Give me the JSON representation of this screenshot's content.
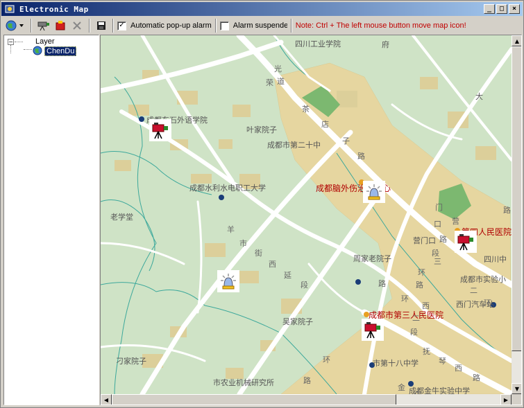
{
  "window": {
    "title": "Electronic Map",
    "buttons": {
      "minimize": "_",
      "maximize": "□",
      "close": "×"
    }
  },
  "toolbar": {
    "auto_popup_label": "Automatic pop-up alarm",
    "auto_popup_checked": true,
    "auto_popup_mark": "✓",
    "alarm_suspended_label": "Alarm suspended",
    "alarm_suspended_checked": false,
    "note": "Note: Ctrl  +  The left mouse button move map icon!"
  },
  "tree": {
    "root_label": "Layer",
    "child_label": "ChenDu"
  },
  "map": {
    "labels": [
      "四川工业学院",
      "成都东石外语学院",
      "叶家院子",
      "成都市第二十中",
      "成都水利水电职工大学",
      "老学堂",
      "成都脑外伤治疗中心",
      "周家老院子",
      "吴家院子",
      "刁家院子",
      "市农业机械研究所",
      "市第十八中学",
      "成都金牛实验中学",
      "成都市实验小",
      "四川中",
      "西门汽车站",
      "营门口",
      "成都市第三人民医院",
      "第四人民医院",
      "大",
      "府"
    ],
    "roads": [
      "羊",
      "市",
      "街",
      "西",
      "延",
      "段",
      "茶",
      "店",
      "子",
      "路",
      "营",
      "门",
      "口",
      "路",
      "段",
      "三",
      "环",
      "路",
      "西",
      "二",
      "段",
      "二",
      "环",
      "路",
      "抚",
      "琴",
      "西",
      "路",
      "金",
      "牛",
      "光",
      "荣",
      "道",
      "环",
      "路",
      "环",
      "路"
    ],
    "colors": {
      "water": "#3ca89b",
      "land": "#cfe3c6",
      "block": "#e6d6a0",
      "road": "#ffffff",
      "park": "#7cb870"
    }
  },
  "markers": [
    {
      "name": "camera",
      "icon": "camera-icon"
    },
    {
      "name": "alarm",
      "icon": "alarm-light-icon"
    },
    {
      "name": "alarm",
      "icon": "alarm-light-icon"
    },
    {
      "name": "camera",
      "icon": "camera-icon"
    },
    {
      "name": "camera",
      "icon": "camera-icon"
    }
  ]
}
